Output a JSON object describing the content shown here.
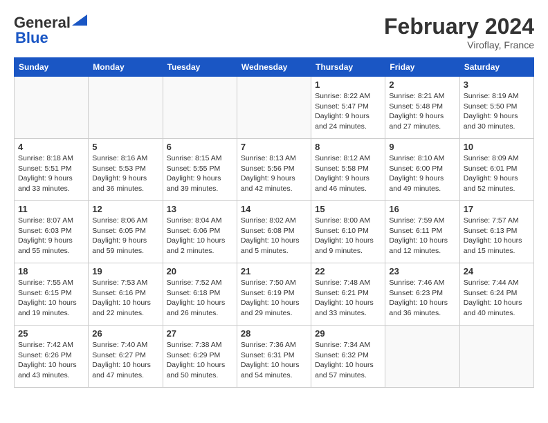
{
  "header": {
    "logo_line1": "General",
    "logo_line2": "Blue",
    "month_title": "February 2024",
    "location": "Viroflay, France"
  },
  "calendar": {
    "headers": [
      "Sunday",
      "Monday",
      "Tuesday",
      "Wednesday",
      "Thursday",
      "Friday",
      "Saturday"
    ],
    "weeks": [
      [
        {
          "day": "",
          "info": ""
        },
        {
          "day": "",
          "info": ""
        },
        {
          "day": "",
          "info": ""
        },
        {
          "day": "",
          "info": ""
        },
        {
          "day": "1",
          "info": "Sunrise: 8:22 AM\nSunset: 5:47 PM\nDaylight: 9 hours\nand 24 minutes."
        },
        {
          "day": "2",
          "info": "Sunrise: 8:21 AM\nSunset: 5:48 PM\nDaylight: 9 hours\nand 27 minutes."
        },
        {
          "day": "3",
          "info": "Sunrise: 8:19 AM\nSunset: 5:50 PM\nDaylight: 9 hours\nand 30 minutes."
        }
      ],
      [
        {
          "day": "4",
          "info": "Sunrise: 8:18 AM\nSunset: 5:51 PM\nDaylight: 9 hours\nand 33 minutes."
        },
        {
          "day": "5",
          "info": "Sunrise: 8:16 AM\nSunset: 5:53 PM\nDaylight: 9 hours\nand 36 minutes."
        },
        {
          "day": "6",
          "info": "Sunrise: 8:15 AM\nSunset: 5:55 PM\nDaylight: 9 hours\nand 39 minutes."
        },
        {
          "day": "7",
          "info": "Sunrise: 8:13 AM\nSunset: 5:56 PM\nDaylight: 9 hours\nand 42 minutes."
        },
        {
          "day": "8",
          "info": "Sunrise: 8:12 AM\nSunset: 5:58 PM\nDaylight: 9 hours\nand 46 minutes."
        },
        {
          "day": "9",
          "info": "Sunrise: 8:10 AM\nSunset: 6:00 PM\nDaylight: 9 hours\nand 49 minutes."
        },
        {
          "day": "10",
          "info": "Sunrise: 8:09 AM\nSunset: 6:01 PM\nDaylight: 9 hours\nand 52 minutes."
        }
      ],
      [
        {
          "day": "11",
          "info": "Sunrise: 8:07 AM\nSunset: 6:03 PM\nDaylight: 9 hours\nand 55 minutes."
        },
        {
          "day": "12",
          "info": "Sunrise: 8:06 AM\nSunset: 6:05 PM\nDaylight: 9 hours\nand 59 minutes."
        },
        {
          "day": "13",
          "info": "Sunrise: 8:04 AM\nSunset: 6:06 PM\nDaylight: 10 hours\nand 2 minutes."
        },
        {
          "day": "14",
          "info": "Sunrise: 8:02 AM\nSunset: 6:08 PM\nDaylight: 10 hours\nand 5 minutes."
        },
        {
          "day": "15",
          "info": "Sunrise: 8:00 AM\nSunset: 6:10 PM\nDaylight: 10 hours\nand 9 minutes."
        },
        {
          "day": "16",
          "info": "Sunrise: 7:59 AM\nSunset: 6:11 PM\nDaylight: 10 hours\nand 12 minutes."
        },
        {
          "day": "17",
          "info": "Sunrise: 7:57 AM\nSunset: 6:13 PM\nDaylight: 10 hours\nand 15 minutes."
        }
      ],
      [
        {
          "day": "18",
          "info": "Sunrise: 7:55 AM\nSunset: 6:15 PM\nDaylight: 10 hours\nand 19 minutes."
        },
        {
          "day": "19",
          "info": "Sunrise: 7:53 AM\nSunset: 6:16 PM\nDaylight: 10 hours\nand 22 minutes."
        },
        {
          "day": "20",
          "info": "Sunrise: 7:52 AM\nSunset: 6:18 PM\nDaylight: 10 hours\nand 26 minutes."
        },
        {
          "day": "21",
          "info": "Sunrise: 7:50 AM\nSunset: 6:19 PM\nDaylight: 10 hours\nand 29 minutes."
        },
        {
          "day": "22",
          "info": "Sunrise: 7:48 AM\nSunset: 6:21 PM\nDaylight: 10 hours\nand 33 minutes."
        },
        {
          "day": "23",
          "info": "Sunrise: 7:46 AM\nSunset: 6:23 PM\nDaylight: 10 hours\nand 36 minutes."
        },
        {
          "day": "24",
          "info": "Sunrise: 7:44 AM\nSunset: 6:24 PM\nDaylight: 10 hours\nand 40 minutes."
        }
      ],
      [
        {
          "day": "25",
          "info": "Sunrise: 7:42 AM\nSunset: 6:26 PM\nDaylight: 10 hours\nand 43 minutes."
        },
        {
          "day": "26",
          "info": "Sunrise: 7:40 AM\nSunset: 6:27 PM\nDaylight: 10 hours\nand 47 minutes."
        },
        {
          "day": "27",
          "info": "Sunrise: 7:38 AM\nSunset: 6:29 PM\nDaylight: 10 hours\nand 50 minutes."
        },
        {
          "day": "28",
          "info": "Sunrise: 7:36 AM\nSunset: 6:31 PM\nDaylight: 10 hours\nand 54 minutes."
        },
        {
          "day": "29",
          "info": "Sunrise: 7:34 AM\nSunset: 6:32 PM\nDaylight: 10 hours\nand 57 minutes."
        },
        {
          "day": "",
          "info": ""
        },
        {
          "day": "",
          "info": ""
        }
      ]
    ]
  }
}
